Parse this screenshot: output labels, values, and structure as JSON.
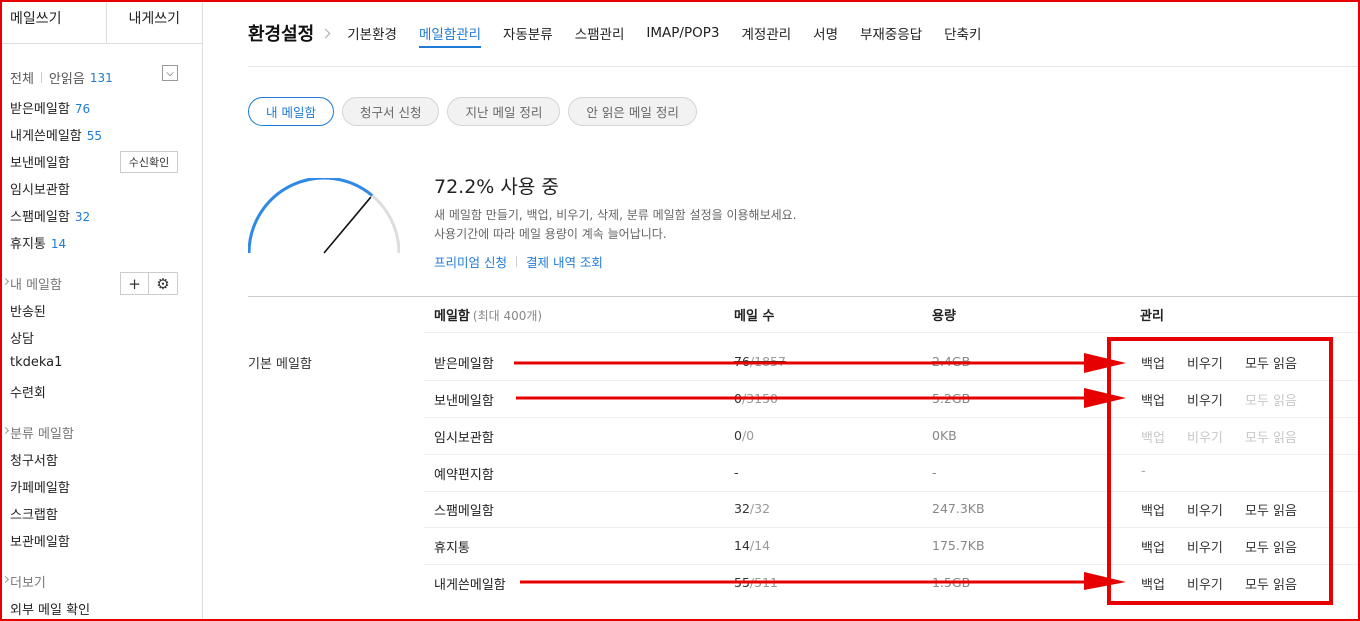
{
  "sidebar": {
    "write_mail": "메일쓰기",
    "write_self": "내게쓰기",
    "filter_all": "전체",
    "filter_unread": "안읽음",
    "unread_count": "131",
    "default_boxes": [
      {
        "label": "받은메일함",
        "count": "76"
      },
      {
        "label": "내게쓴메일함",
        "count": "55"
      },
      {
        "label": "보낸메일함",
        "count": ""
      },
      {
        "label": "임시보관함",
        "count": ""
      },
      {
        "label": "스팸메일함",
        "count": "32"
      },
      {
        "label": "휴지통",
        "count": "14"
      }
    ],
    "receipt_button": "수신확인",
    "my_boxes_head": "내 메일함",
    "my_boxes": [
      "반송된",
      "상담",
      "tkdeka1",
      "수련회"
    ],
    "category_head": "분류 메일함",
    "category_boxes": [
      "청구서함",
      "카페메일함",
      "스크랩함",
      "보관메일함"
    ],
    "more_head": "더보기",
    "external_check": "외부 메일 확인"
  },
  "header": {
    "title": "환경설정",
    "tabs": [
      "기본환경",
      "메일함관리",
      "자동분류",
      "스팸관리",
      "IMAP/POP3",
      "계정관리",
      "서명",
      "부재중응답",
      "단축키"
    ],
    "active_tab": "메일함관리"
  },
  "pills": [
    "내 메일함",
    "청구서 신청",
    "지난 메일 정리",
    "안 읽은 메일 정리"
  ],
  "usage": {
    "percent": 72.2,
    "title": "72.2% 사용 중",
    "desc1": "새 메일함 만들기, 백업, 비우기, 삭제, 분류 메일함 설정을 이용해보세요.",
    "desc2": "사용기간에 따라 메일 용량이 계속 늘어납니다.",
    "link_premium": "프리미엄 신청",
    "link_payment": "결제 내역 조회"
  },
  "table": {
    "col_mailbox": "메일함",
    "col_mailbox_note": "(최대 400개)",
    "col_count": "메일 수",
    "col_size": "용량",
    "col_manage": "관리",
    "group_label": "기본 메일함",
    "rows": [
      {
        "name": "받은메일함",
        "count": "76",
        "total": "/1857",
        "size": "2.4GB"
      },
      {
        "name": "보낸메일함",
        "count": "0",
        "total": "/3150",
        "size": "5.2GB"
      },
      {
        "name": "임시보관함",
        "count": "0",
        "total": "/0",
        "size": "0KB"
      },
      {
        "name": "예약편지함",
        "count": "-",
        "total": "",
        "size": "-"
      },
      {
        "name": "스팸메일함",
        "count": "32",
        "total": "/32",
        "size": "247.3KB"
      },
      {
        "name": "휴지통",
        "count": "14",
        "total": "/14",
        "size": "175.7KB"
      },
      {
        "name": "내게쓴메일함",
        "count": "55",
        "total": "/511",
        "size": "1.5GB"
      }
    ],
    "action_backup": "백업",
    "action_empty": "비우기",
    "action_readall": "모두 읽음",
    "action_dash": "-"
  },
  "annotation_color": "#e60000"
}
